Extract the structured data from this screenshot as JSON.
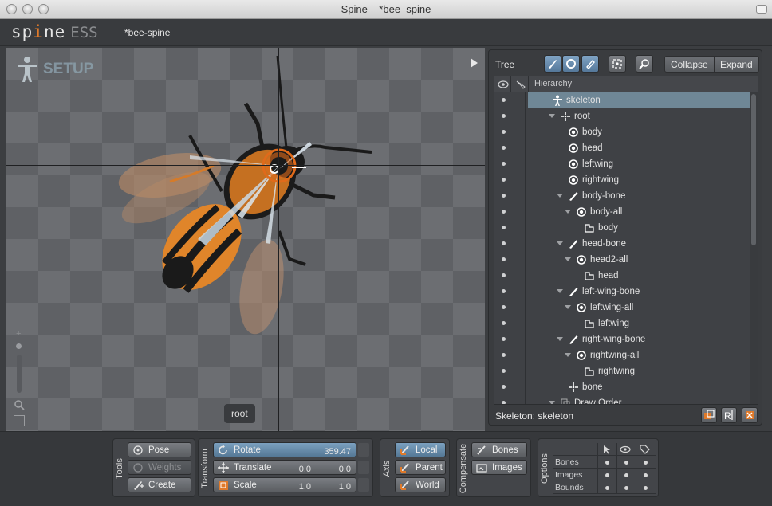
{
  "window": {
    "title": "Spine – *bee–spine"
  },
  "header": {
    "logo_text": "sp",
    "logo_accent": "i",
    "logo_text2": "ne",
    "logo_edition": "ESS",
    "project_name": "*bee-spine"
  },
  "viewport": {
    "mode_label": "SETUP",
    "selected_bone_label": "root"
  },
  "tree": {
    "title": "Tree",
    "collapse_label": "Collapse",
    "expand_label": "Expand",
    "hierarchy_header": "Hierarchy",
    "footer": "Skeleton: skeleton",
    "rows": [
      {
        "label": "skeleton",
        "icon": "skeleton-icon",
        "depth": 0,
        "expander": false,
        "selected": true
      },
      {
        "label": "root",
        "icon": "root-bone-icon",
        "depth": 1,
        "expander": true
      },
      {
        "label": "body",
        "icon": "slot-icon",
        "depth": 2,
        "expander": false
      },
      {
        "label": "head",
        "icon": "slot-icon",
        "depth": 2,
        "expander": false
      },
      {
        "label": "leftwing",
        "icon": "slot-icon",
        "depth": 2,
        "expander": false
      },
      {
        "label": "rightwing",
        "icon": "slot-icon",
        "depth": 2,
        "expander": false
      },
      {
        "label": "body-bone",
        "icon": "bone-icon",
        "depth": 2,
        "expander": true
      },
      {
        "label": "body-all",
        "icon": "slot-icon",
        "depth": 3,
        "expander": true
      },
      {
        "label": "body",
        "icon": "image-attachment-icon",
        "depth": 4,
        "expander": false
      },
      {
        "label": "head-bone",
        "icon": "bone-icon",
        "depth": 2,
        "expander": true
      },
      {
        "label": "head2-all",
        "icon": "slot-icon",
        "depth": 3,
        "expander": true
      },
      {
        "label": "head",
        "icon": "image-attachment-icon",
        "depth": 4,
        "expander": false
      },
      {
        "label": "left-wing-bone",
        "icon": "bone-icon",
        "depth": 2,
        "expander": true
      },
      {
        "label": "leftwing-all",
        "icon": "slot-icon",
        "depth": 3,
        "expander": true
      },
      {
        "label": "leftwing",
        "icon": "image-attachment-icon",
        "depth": 4,
        "expander": false
      },
      {
        "label": "right-wing-bone",
        "icon": "bone-icon",
        "depth": 2,
        "expander": true
      },
      {
        "label": "rightwing-all",
        "icon": "slot-icon",
        "depth": 3,
        "expander": true
      },
      {
        "label": "rightwing",
        "icon": "image-attachment-icon",
        "depth": 4,
        "expander": false
      },
      {
        "label": "bone",
        "icon": "root-bone-icon",
        "depth": 2,
        "expander": false
      },
      {
        "label": "Draw Order",
        "icon": "draw-order-icon",
        "depth": 1,
        "expander": true
      }
    ]
  },
  "tools": {
    "group_label": "Tools",
    "pose_label": "Pose",
    "weights_label": "Weights",
    "create_label": "Create"
  },
  "transform": {
    "group_label": "Transform",
    "rotate_label": "Rotate",
    "rotate_value": "359.47",
    "translate_label": "Translate",
    "translate_x": "0.0",
    "translate_y": "0.0",
    "scale_label": "Scale",
    "scale_x": "1.0",
    "scale_y": "1.0"
  },
  "axis": {
    "group_label": "Axis",
    "local_label": "Local",
    "parent_label": "Parent",
    "world_label": "World"
  },
  "compensate": {
    "group_label": "Compensate",
    "bones_label": "Bones",
    "images_label": "Images"
  },
  "options": {
    "group_label": "Options",
    "rows": [
      {
        "label": "Bones"
      },
      {
        "label": "Images"
      },
      {
        "label": "Bounds"
      }
    ]
  },
  "colors": {
    "accent_orange": "#e07a2a",
    "selection": "#6f8796",
    "active_button": "#6c90b0"
  }
}
